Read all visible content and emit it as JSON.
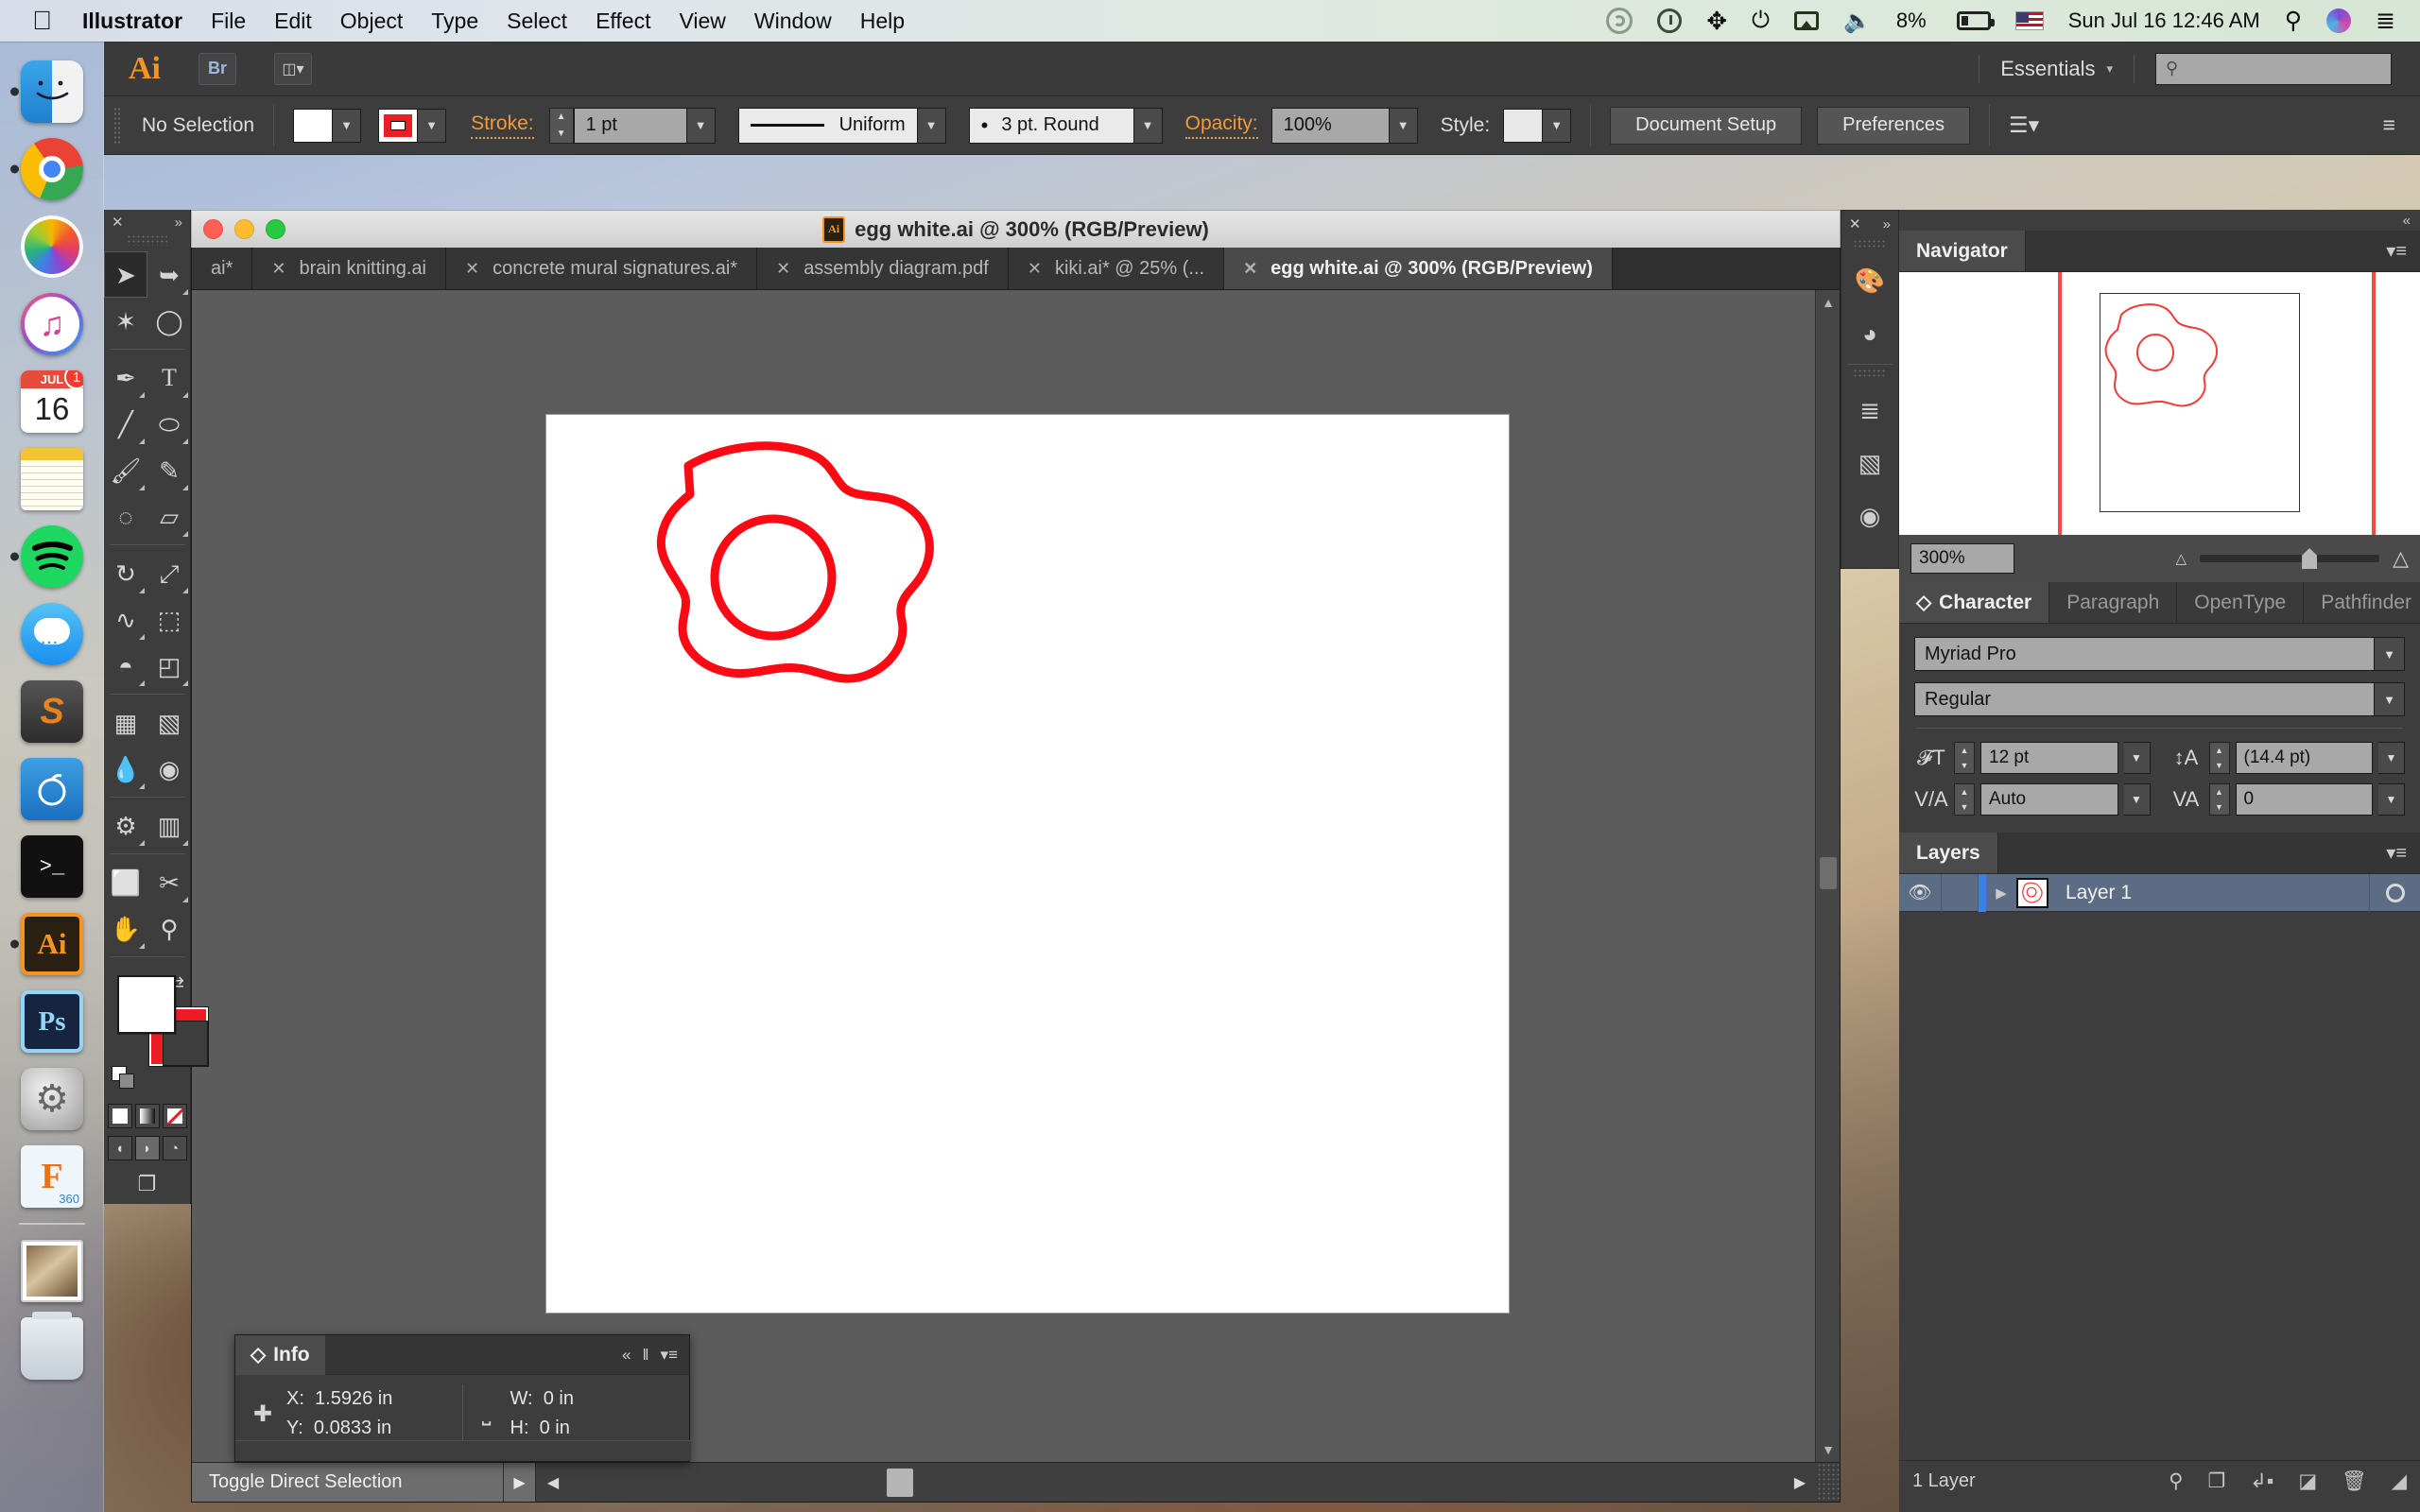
{
  "menubar": {
    "apple_icon": "apple-icon",
    "items": [
      "Illustrator",
      "File",
      "Edit",
      "Object",
      "Type",
      "Select",
      "Effect",
      "View",
      "Window",
      "Help"
    ],
    "status": {
      "creative_cloud_icon": "creative-cloud-icon",
      "timemachine_icon": "time-machine-icon",
      "bluetooth_icon": "bluetooth-icon",
      "wifi_icon": "wifi-icon",
      "airplay_icon": "airplay-icon",
      "volume_icon": "volume-icon",
      "battery_percent": "8%",
      "battery_icon": "battery-icon",
      "flag_icon": "us-flag-icon",
      "datetime": "Sun Jul 16  12:46 AM",
      "search_icon": "spotlight-search-icon",
      "siri_icon": "siri-icon",
      "notifications_icon": "notification-center-icon"
    }
  },
  "dock": {
    "items": [
      {
        "name": "finder",
        "label": "Finder",
        "running": true
      },
      {
        "name": "chrome",
        "label": "Google Chrome",
        "running": true
      },
      {
        "name": "photos",
        "label": "Photos",
        "running": false
      },
      {
        "name": "itunes",
        "label": "iTunes",
        "running": false
      },
      {
        "name": "calendar",
        "label": "Calendar",
        "running": false,
        "month": "JUL",
        "day": "16",
        "badge": "1"
      },
      {
        "name": "notes",
        "label": "Notes",
        "running": false
      },
      {
        "name": "spotify",
        "label": "Spotify",
        "running": true
      },
      {
        "name": "messages",
        "label": "Messages",
        "running": false
      },
      {
        "name": "sublime-text",
        "label": "Sublime Text",
        "running": false,
        "glyph": "S"
      },
      {
        "name": "pomodoro",
        "label": "Pomodoro",
        "running": false
      },
      {
        "name": "terminal",
        "label": "Terminal",
        "running": false,
        "glyph": ">_"
      },
      {
        "name": "illustrator",
        "label": "Adobe Illustrator",
        "running": true,
        "glyph": "Ai"
      },
      {
        "name": "photoshop",
        "label": "Adobe Photoshop",
        "running": false,
        "glyph": "Ps"
      },
      {
        "name": "system-preferences",
        "label": "System Preferences",
        "running": false
      },
      {
        "name": "fusion-360",
        "label": "Fusion 360",
        "running": false,
        "glyph": "F",
        "sub": "360"
      },
      {
        "name": "downloads-stack",
        "label": "Downloads",
        "running": false
      },
      {
        "name": "trash",
        "label": "Trash",
        "running": false
      }
    ]
  },
  "appbar": {
    "logo": "Ai",
    "bridge_label": "Br",
    "arrange_icon": "arrange-documents-icon",
    "workspace_name": "Essentials",
    "workspace_caret": "▾",
    "search_placeholder": "",
    "search_icon": "search-icon"
  },
  "controlbar": {
    "selection_status": "No Selection",
    "fill_label": "fill-swatch",
    "stroke_swatch_label": "stroke-swatch",
    "stroke_label": "Stroke:",
    "stroke_weight": "1 pt",
    "stroke_profile": "Uniform",
    "brush_definition": "3 pt. Round",
    "opacity_label": "Opacity:",
    "opacity_value": "100%",
    "style_label": "Style:",
    "document_setup": "Document Setup",
    "preferences": "Preferences",
    "align_icon": "align-icon",
    "panel_menu_icon": "panel-menu-icon"
  },
  "document": {
    "title": "egg white.ai @ 300% (RGB/Preview)",
    "traffic_lights": [
      "close",
      "minimize",
      "zoom"
    ],
    "tabs": [
      {
        "label": "ai*",
        "active": false,
        "truncated": true
      },
      {
        "label": "brain knitting.ai",
        "active": false
      },
      {
        "label": "concrete mural signatures.ai*",
        "active": false
      },
      {
        "label": "assembly diagram.pdf",
        "active": false
      },
      {
        "label": "kiki.ai* @ 25% (...",
        "active": false
      },
      {
        "label": "egg white.ai @ 300% (RGB/Preview)",
        "active": true
      }
    ],
    "statusbar": {
      "status_text": "Toggle Direct Selection",
      "status_arrow": "▶",
      "scroll_left": "◀",
      "scroll_right": "▶"
    },
    "artwork_stroke_color": "#fa0a14"
  },
  "tools": {
    "header_close_icon": "close-icon",
    "header_expand_icon": "double-chevron-icon",
    "items": [
      {
        "name": "selection-tool",
        "glyph": "➤",
        "selected": true,
        "has_flyout": false
      },
      {
        "name": "direct-selection-tool",
        "glyph": "➤",
        "selected": false,
        "has_flyout": true
      },
      {
        "name": "magic-wand-tool",
        "glyph": "✶",
        "selected": false,
        "has_flyout": false
      },
      {
        "name": "lasso-tool",
        "glyph": "◌",
        "selected": false,
        "has_flyout": false
      },
      {
        "name": "pen-tool",
        "glyph": "✒",
        "selected": false,
        "has_flyout": true
      },
      {
        "name": "type-tool",
        "glyph": "T",
        "selected": false,
        "has_flyout": true
      },
      {
        "name": "line-segment-tool",
        "glyph": "╱",
        "selected": false,
        "has_flyout": true
      },
      {
        "name": "ellipse-tool",
        "glyph": "⬭",
        "selected": false,
        "has_flyout": true
      },
      {
        "name": "paintbrush-tool",
        "glyph": "🖌",
        "selected": false,
        "has_flyout": true
      },
      {
        "name": "pencil-tool",
        "glyph": "✏",
        "selected": false,
        "has_flyout": true
      },
      {
        "name": "blob-brush-tool",
        "glyph": "◍",
        "selected": false,
        "has_flyout": false
      },
      {
        "name": "eraser-tool",
        "glyph": "▱",
        "selected": false,
        "has_flyout": true
      },
      {
        "name": "rotate-tool",
        "glyph": "↻",
        "selected": false,
        "has_flyout": true
      },
      {
        "name": "scale-tool",
        "glyph": "⤢",
        "selected": false,
        "has_flyout": true
      },
      {
        "name": "width-tool",
        "glyph": "∿",
        "selected": false,
        "has_flyout": true
      },
      {
        "name": "free-transform-tool",
        "glyph": "⬚",
        "selected": false,
        "has_flyout": false
      },
      {
        "name": "shape-builder-tool",
        "glyph": "◓",
        "selected": false,
        "has_flyout": true
      },
      {
        "name": "perspective-grid-tool",
        "glyph": "◰",
        "selected": false,
        "has_flyout": true
      },
      {
        "name": "mesh-tool",
        "glyph": "⌗",
        "selected": false,
        "has_flyout": false
      },
      {
        "name": "gradient-tool",
        "glyph": "▤",
        "selected": false,
        "has_flyout": false
      },
      {
        "name": "eyedropper-tool",
        "glyph": "⚲",
        "selected": false,
        "has_flyout": true
      },
      {
        "name": "blend-tool",
        "glyph": "◎",
        "selected": false,
        "has_flyout": false
      },
      {
        "name": "symbol-sprayer-tool",
        "glyph": "⛾",
        "selected": false,
        "has_flyout": true
      },
      {
        "name": "column-graph-tool",
        "glyph": "▥",
        "selected": false,
        "has_flyout": true
      },
      {
        "name": "artboard-tool",
        "glyph": "⛶",
        "selected": false,
        "has_flyout": false
      },
      {
        "name": "slice-tool",
        "glyph": "✄",
        "selected": false,
        "has_flyout": true
      },
      {
        "name": "hand-tool",
        "glyph": "✋",
        "selected": false,
        "has_flyout": true
      },
      {
        "name": "zoom-tool",
        "glyph": "⚲",
        "selected": false,
        "has_flyout": false
      }
    ],
    "fill_color": "#ffffff",
    "stroke_color": "#ee1c25",
    "swap_icon": "swap-fill-stroke-icon",
    "default_icon": "default-fill-stroke-icon",
    "mini_buttons": [
      {
        "name": "color-button",
        "type": "white",
        "active": false
      },
      {
        "name": "gradient-button",
        "type": "gradient",
        "active": false
      },
      {
        "name": "none-button",
        "type": "none",
        "active": false
      }
    ],
    "draw_modes": [
      {
        "name": "draw-normal-mode",
        "glyph": "◒",
        "active": false
      },
      {
        "name": "draw-behind-mode",
        "glyph": "◓",
        "active": true
      },
      {
        "name": "draw-inside-mode",
        "glyph": "◔",
        "active": false
      }
    ],
    "screen_mode_icon": "change-screen-mode-icon"
  },
  "panel_dock": {
    "close_icon": "close-icon",
    "expand_icon": "double-chevron-right-icon",
    "icons": [
      {
        "name": "swatches-panel-icon",
        "glyph": "🎨"
      },
      {
        "name": "color-guide-panel-icon",
        "glyph": "◕"
      },
      {
        "name": "align-panel-icon",
        "glyph": "≡"
      },
      {
        "name": "gradient-panel-icon",
        "glyph": "▤"
      },
      {
        "name": "transparency-panel-icon",
        "glyph": "◉"
      }
    ]
  },
  "navigator": {
    "tab_label": "Navigator",
    "menu_icon": "panel-menu-icon",
    "zoom_value": "300%",
    "zoom_out_icon": "small-mountain-icon",
    "zoom_in_icon": "large-mountain-icon",
    "slider_icon": "zoom-slider"
  },
  "character": {
    "tabs": [
      {
        "label": "Character",
        "active": true
      },
      {
        "label": "Paragraph",
        "active": false
      },
      {
        "label": "OpenType",
        "active": false
      },
      {
        "label": "Pathfinder",
        "active": false
      }
    ],
    "menu_icon": "panel-menu-icon",
    "font_family": "Myriad Pro",
    "font_style": "Regular",
    "font_size_icon": "font-size-icon",
    "font_size": "12 pt",
    "leading_icon": "leading-icon",
    "leading": "(14.4 pt)",
    "kerning_icon": "kerning-icon",
    "kerning": "Auto",
    "tracking_icon": "tracking-icon",
    "tracking": "0"
  },
  "layers": {
    "tab_label": "Layers",
    "menu_icon": "panel-menu-icon",
    "rows": [
      {
        "visibility_icon": "eye-icon",
        "expand_icon": "disclosure-triangle-icon",
        "thumbnail": "layer-thumbnail",
        "name": "Layer 1",
        "target_icon": "target-circle-icon",
        "selected": true
      }
    ],
    "footer_count": "1 Layer",
    "footer_icons": [
      {
        "name": "locate-object-icon",
        "glyph": "⚲"
      },
      {
        "name": "make-clipping-mask-icon",
        "glyph": "❐"
      },
      {
        "name": "create-new-sublayer-icon",
        "glyph": "⇱"
      },
      {
        "name": "create-new-layer-icon",
        "glyph": "◪"
      },
      {
        "name": "delete-selection-icon",
        "glyph": "🗑"
      }
    ]
  },
  "info": {
    "tab_label": "Info",
    "collapse_icon": "double-chevron-left-icon",
    "menu_icon": "panel-menu-icon",
    "position_icon": "crosshair-icon",
    "x_label": "X:",
    "x_value": "1.5926 in",
    "y_label": "Y:",
    "y_value": "0.0833 in",
    "size_icon": "bounding-box-icon",
    "w_label": "W:",
    "w_value": "0 in",
    "h_label": "H:",
    "h_value": "0 in"
  }
}
